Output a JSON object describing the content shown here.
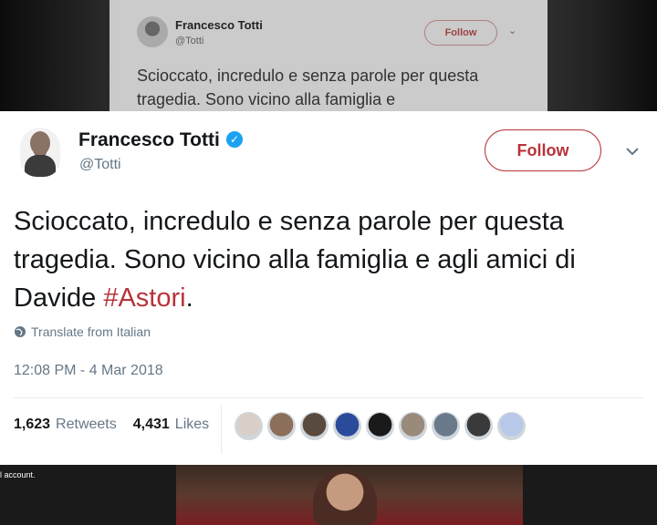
{
  "background_tweet": {
    "name": "Francesco Totti",
    "handle": "@Totti",
    "follow_label": "Follow",
    "text": "Scioccato, incredulo e senza parole per questa tragedia. Sono vicino alla famiglia e"
  },
  "account_note": "l account.",
  "tweet": {
    "name": "Francesco Totti",
    "handle": "@Totti",
    "follow_label": "Follow",
    "text_before": "Scioccato, incredulo e senza parole per questa tragedia. Sono vicino alla famiglia e agli amici di Davide ",
    "hashtag": "#Astori",
    "text_after": ".",
    "translate_label": "Translate from Italian",
    "timestamp": "12:08 PM - 4 Mar 2018",
    "retweets_count": "1,623",
    "retweets_label": "Retweets",
    "likes_count": "4,431",
    "likes_label": "Likes"
  },
  "likers": [
    {
      "color": "#d9cfc6"
    },
    {
      "color": "#8b6f5a"
    },
    {
      "color": "#5a4a3e"
    },
    {
      "color": "#2a4a9a"
    },
    {
      "color": "#1a1a1a"
    },
    {
      "color": "#9a8a7a"
    },
    {
      "color": "#6a7a8a"
    },
    {
      "color": "#3a3a3a"
    },
    {
      "color": "#b8c8e8"
    }
  ],
  "colors": {
    "accent": "#b8333a",
    "verified": "#1da1f2",
    "secondary_text": "#657786"
  }
}
